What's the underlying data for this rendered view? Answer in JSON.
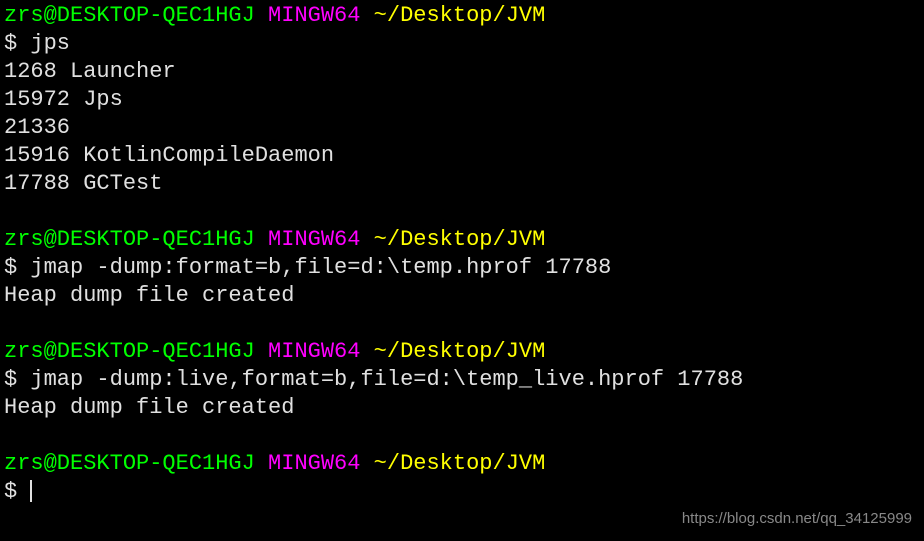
{
  "prompt": {
    "user_host": "zrs@DESKTOP-QEC1HGJ",
    "env": "MINGW64",
    "path": "~/Desktop/JVM",
    "symbol": "$"
  },
  "blocks": [
    {
      "command": "jps",
      "output": [
        "1268 Launcher",
        "15972 Jps",
        "21336",
        "15916 KotlinCompileDaemon",
        "17788 GCTest"
      ]
    },
    {
      "command": "jmap -dump:format=b,file=d:\\temp.hprof 17788",
      "output": [
        "Heap dump file created"
      ]
    },
    {
      "command": "jmap -dump:live,format=b,file=d:\\temp_live.hprof 17788",
      "output": [
        "Heap dump file created"
      ]
    }
  ],
  "watermark": "https://blog.csdn.net/qq_34125999"
}
